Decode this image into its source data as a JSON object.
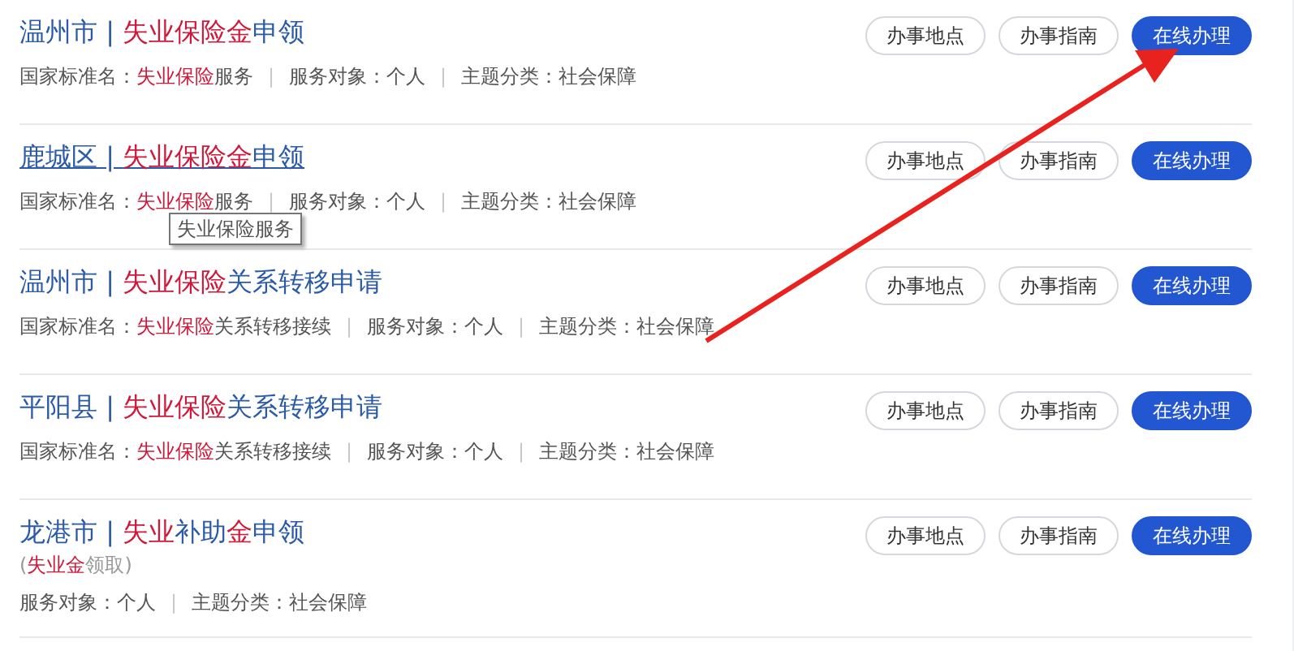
{
  "items": [
    {
      "title": [
        {
          "text": "温州市 | ",
          "highlight": false
        },
        {
          "text": "失业保险金",
          "highlight": true
        },
        {
          "text": "申领",
          "highlight": false
        }
      ],
      "hovered": false,
      "meta": [
        {
          "kind": "field",
          "segments": [
            {
              "text": "国家标准名：",
              "highlight": false
            },
            {
              "text": "失业保险",
              "highlight": true
            },
            {
              "text": "服务",
              "highlight": false
            }
          ]
        },
        {
          "kind": "separator",
          "segments": [
            {
              "text": "|",
              "highlight": false
            }
          ]
        },
        {
          "kind": "field",
          "segments": [
            {
              "text": "服务对象：个人",
              "highlight": false
            }
          ]
        },
        {
          "kind": "separator",
          "segments": [
            {
              "text": "|",
              "highlight": false
            }
          ]
        },
        {
          "kind": "field",
          "segments": [
            {
              "text": "主题分类：社会保障",
              "highlight": false
            }
          ]
        }
      ],
      "buttons": [
        {
          "label": "办事地点",
          "kind": "outline"
        },
        {
          "label": "办事指南",
          "kind": "outline"
        },
        {
          "label": "在线办理",
          "kind": "primary"
        }
      ]
    },
    {
      "title": [
        {
          "text": "鹿城区 | ",
          "highlight": false
        },
        {
          "text": "失业保险金",
          "highlight": true
        },
        {
          "text": "申领",
          "highlight": false
        }
      ],
      "hovered": true,
      "meta": [
        {
          "kind": "field",
          "segments": [
            {
              "text": "国家标准名：",
              "highlight": false
            },
            {
              "text": "失业保险",
              "highlight": true
            },
            {
              "text": "服务",
              "highlight": false
            }
          ]
        },
        {
          "kind": "separator",
          "segments": [
            {
              "text": "|",
              "highlight": false
            }
          ]
        },
        {
          "kind": "field",
          "segments": [
            {
              "text": "服务对象：个人",
              "highlight": false
            }
          ]
        },
        {
          "kind": "separator",
          "segments": [
            {
              "text": "|",
              "highlight": false
            }
          ]
        },
        {
          "kind": "field",
          "segments": [
            {
              "text": "主题分类：社会保障",
              "highlight": false
            }
          ]
        }
      ],
      "tooltip": "失业保险服务",
      "buttons": [
        {
          "label": "办事地点",
          "kind": "outline"
        },
        {
          "label": "办事指南",
          "kind": "outline"
        },
        {
          "label": "在线办理",
          "kind": "primary"
        }
      ]
    },
    {
      "title": [
        {
          "text": "温州市 | ",
          "highlight": false
        },
        {
          "text": "失业保险",
          "highlight": true
        },
        {
          "text": "关系转移申请",
          "highlight": false
        }
      ],
      "hovered": false,
      "meta": [
        {
          "kind": "field",
          "segments": [
            {
              "text": "国家标准名：",
              "highlight": false
            },
            {
              "text": "失业保险",
              "highlight": true
            },
            {
              "text": "关系转移接续",
              "highlight": false
            }
          ]
        },
        {
          "kind": "separator",
          "segments": [
            {
              "text": "|",
              "highlight": false
            }
          ]
        },
        {
          "kind": "field",
          "segments": [
            {
              "text": "服务对象：个人",
              "highlight": false
            }
          ]
        },
        {
          "kind": "separator",
          "segments": [
            {
              "text": "|",
              "highlight": false
            }
          ]
        },
        {
          "kind": "field",
          "segments": [
            {
              "text": "主题分类：社会保障",
              "highlight": false
            }
          ]
        }
      ],
      "buttons": [
        {
          "label": "办事地点",
          "kind": "outline"
        },
        {
          "label": "办事指南",
          "kind": "outline"
        },
        {
          "label": "在线办理",
          "kind": "primary"
        }
      ]
    },
    {
      "title": [
        {
          "text": "平阳县 | ",
          "highlight": false
        },
        {
          "text": "失业保险",
          "highlight": true
        },
        {
          "text": "关系转移申请",
          "highlight": false
        }
      ],
      "hovered": false,
      "meta": [
        {
          "kind": "field",
          "segments": [
            {
              "text": "国家标准名：",
              "highlight": false
            },
            {
              "text": "失业保险",
              "highlight": true
            },
            {
              "text": "关系转移接续",
              "highlight": false
            }
          ]
        },
        {
          "kind": "separator",
          "segments": [
            {
              "text": "|",
              "highlight": false
            }
          ]
        },
        {
          "kind": "field",
          "segments": [
            {
              "text": "服务对象：个人",
              "highlight": false
            }
          ]
        },
        {
          "kind": "separator",
          "segments": [
            {
              "text": "|",
              "highlight": false
            }
          ]
        },
        {
          "kind": "field",
          "segments": [
            {
              "text": "主题分类：社会保障",
              "highlight": false
            }
          ]
        }
      ],
      "buttons": [
        {
          "label": "办事地点",
          "kind": "outline"
        },
        {
          "label": "办事指南",
          "kind": "outline"
        },
        {
          "label": "在线办理",
          "kind": "primary"
        }
      ]
    },
    {
      "title": [
        {
          "text": "龙港市 | ",
          "highlight": false
        },
        {
          "text": "失业",
          "highlight": true
        },
        {
          "text": "补助",
          "highlight": false
        },
        {
          "text": "金",
          "highlight": true
        },
        {
          "text": "申领",
          "highlight": false
        }
      ],
      "hovered": false,
      "subtitle": [
        {
          "text": "(",
          "highlight": false
        },
        {
          "text": "失业金",
          "highlight": true
        },
        {
          "text": "领取)",
          "highlight": false
        }
      ],
      "meta": [
        {
          "kind": "field",
          "segments": [
            {
              "text": "服务对象：个人",
              "highlight": false
            }
          ]
        },
        {
          "kind": "separator",
          "segments": [
            {
              "text": "|",
              "highlight": false
            }
          ]
        },
        {
          "kind": "field",
          "segments": [
            {
              "text": "主题分类：社会保障",
              "highlight": false
            }
          ]
        }
      ],
      "buttons": [
        {
          "label": "办事地点",
          "kind": "outline"
        },
        {
          "label": "办事指南",
          "kind": "outline"
        },
        {
          "label": "在线办理",
          "kind": "primary"
        }
      ]
    }
  ]
}
